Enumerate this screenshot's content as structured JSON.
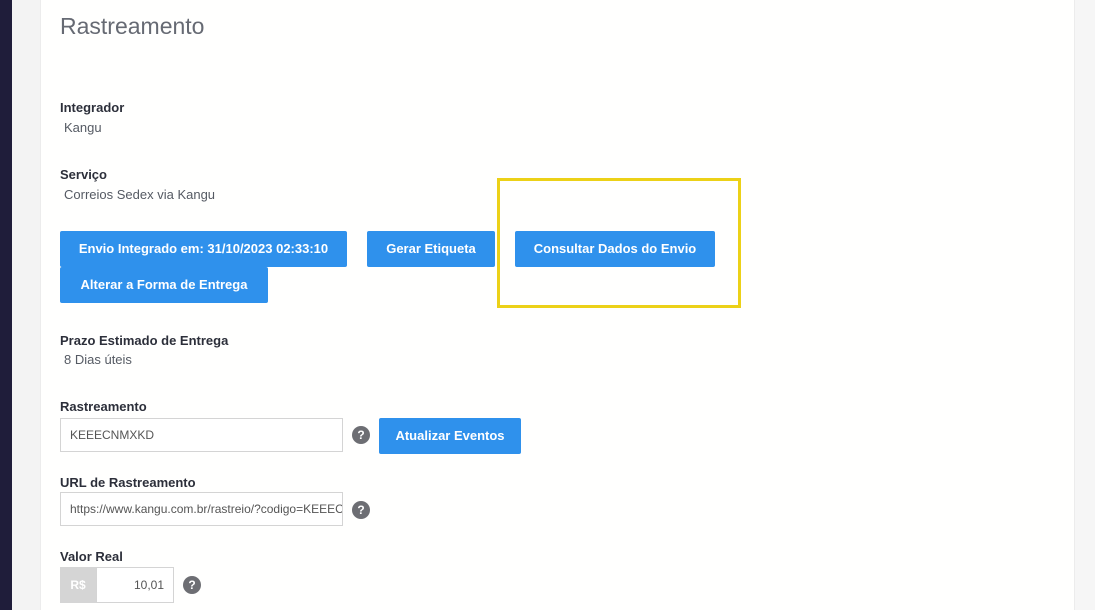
{
  "page": {
    "title": "Rastreamento"
  },
  "integrador": {
    "label": "Integrador",
    "value": "Kangu"
  },
  "servico": {
    "label": "Serviço",
    "value": "Correios Sedex via Kangu"
  },
  "actions": {
    "envio_integrado": "Envio Integrado em: 31/10/2023 02:33:10",
    "gerar_etiqueta": "Gerar Etiqueta",
    "consultar_dados": "Consultar Dados do Envio",
    "alterar_forma": "Alterar a Forma de Entrega"
  },
  "prazo": {
    "label": "Prazo Estimado de Entrega",
    "value": "8 Dias úteis"
  },
  "rastreamento": {
    "label": "Rastreamento",
    "value": "KEEECNMXKD",
    "atualizar_label": "Atualizar Eventos"
  },
  "url_rastreamento": {
    "label": "URL de Rastreamento",
    "value": "https://www.kangu.com.br/rastreio/?codigo=KEEECNMXKD"
  },
  "valor_real": {
    "label": "Valor Real",
    "prefix": "R$",
    "value": "10,01"
  },
  "help": {
    "glyph": "?"
  },
  "colors": {
    "primary_button": "#2f91ec",
    "highlight_box": "#ecd117",
    "sidebar": "#1f1d3a"
  }
}
